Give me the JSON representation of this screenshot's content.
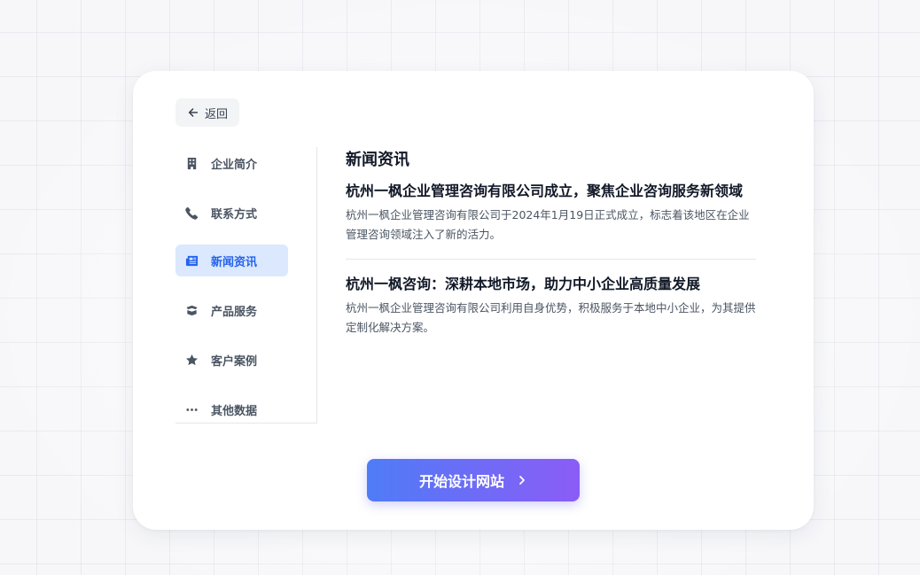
{
  "back": {
    "label": "返回",
    "icon": "arrow-left-icon"
  },
  "sidebar": {
    "items": [
      {
        "label": "企业简介",
        "icon": "building-icon",
        "active": false
      },
      {
        "label": "联系方式",
        "icon": "phone-icon",
        "active": false
      },
      {
        "label": "新闻资讯",
        "icon": "newspaper-icon",
        "active": true
      },
      {
        "label": "产品服务",
        "icon": "box-icon",
        "active": false
      },
      {
        "label": "客户案例",
        "icon": "star-icon",
        "active": false
      },
      {
        "label": "其他数据",
        "icon": "ellipsis-icon",
        "active": false
      }
    ]
  },
  "main": {
    "title": "新闻资讯",
    "articles": [
      {
        "title": "杭州一枫企业管理咨询有限公司成立，聚焦企业咨询服务新领域",
        "summary": "杭州一枫企业管理咨询有限公司于2024年1月19日正式成立，标志着该地区在企业管理咨询领域注入了新的活力。"
      },
      {
        "title": "杭州一枫咨询：深耕本地市场，助力中小企业高质量发展",
        "summary": "杭州一枫企业管理咨询有限公司利用自身优势，积极服务于本地中小企业，为其提供定制化解决方案。"
      }
    ]
  },
  "cta": {
    "label": "开始设计网站",
    "icon": "chevron-right-icon"
  },
  "colors": {
    "accent": "#2563eb",
    "active_bg": "#dbe8fe",
    "cta_gradient_start": "#4f7cf7",
    "cta_gradient_end": "#8b5cf6"
  }
}
